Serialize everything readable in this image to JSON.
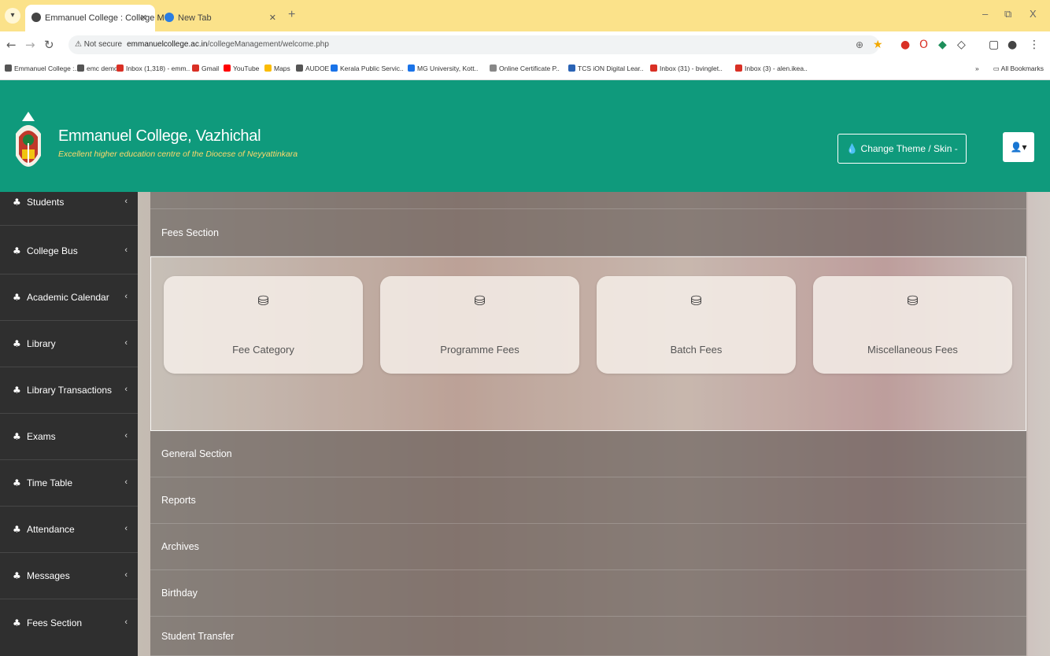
{
  "browser": {
    "active_tab_title": "Emmanuel College : College M",
    "inactive_tab_title": "New Tab",
    "new_tab": "+",
    "win_minimize": "–",
    "win_restore": "⧉",
    "win_close": "X",
    "address": {
      "security_label": "⚠ Not secure",
      "host": "emmanuelcollege.ac.in",
      "path": "/collegeManagement/welcome.php"
    },
    "bookmarks": [
      {
        "label": "Emmanuel College :..",
        "color": "#555555"
      },
      {
        "label": "emc demo",
        "color": "#555555"
      },
      {
        "label": "Inbox (1,318) - emm..",
        "color": "#d93025"
      },
      {
        "label": "Gmail",
        "color": "#d93025"
      },
      {
        "label": "YouTube",
        "color": "#ff0000"
      },
      {
        "label": "Maps",
        "color": "#fbbc04"
      },
      {
        "label": "AUDOE",
        "color": "#555555"
      },
      {
        "label": "Kerala Public Servic..",
        "color": "#1a73e8"
      },
      {
        "label": "MG University, Kott..",
        "color": "#1a73e8"
      },
      {
        "label": "Online Certificate P..",
        "color": "#888888"
      },
      {
        "label": "TCS iON Digital Lear..",
        "color": "#2a63b5"
      },
      {
        "label": "Inbox (31) - bvinglet..",
        "color": "#d93025"
      },
      {
        "label": "Inbox (3) - alen.ikea..",
        "color": "#d93025"
      }
    ],
    "bookmarks_overflow": "»",
    "all_bookmarks": "All Bookmarks"
  },
  "header": {
    "college_name": "Emmanuel College, Vazhichal",
    "tagline": "Excellent higher education centre of the Diocese of Neyyattinkara",
    "theme_button": "💧 Change Theme / Skin -",
    "user_button": "👤▾",
    "bg_color": "#0f9a7c"
  },
  "sidebar": {
    "items": [
      {
        "label": "Students"
      },
      {
        "label": "College Bus"
      },
      {
        "label": "Academic Calendar"
      },
      {
        "label": "Library"
      },
      {
        "label": "Library Transactions"
      },
      {
        "label": "Exams"
      },
      {
        "label": "Time Table"
      },
      {
        "label": "Attendance"
      },
      {
        "label": "Messages"
      },
      {
        "label": "Fees Section"
      }
    ]
  },
  "main": {
    "fees_section_title": "Fees Section",
    "tiles": [
      {
        "label": "Fee Category",
        "icon": "database-icon"
      },
      {
        "label": "Programme Fees",
        "icon": "database-icon"
      },
      {
        "label": "Batch Fees",
        "icon": "database-icon"
      },
      {
        "label": "Miscellaneous Fees",
        "icon": "database-icon"
      }
    ],
    "sections": [
      {
        "label": "General Section"
      },
      {
        "label": "Reports"
      },
      {
        "label": "Archives"
      },
      {
        "label": "Birthday"
      },
      {
        "label": "Student Transfer"
      }
    ]
  }
}
